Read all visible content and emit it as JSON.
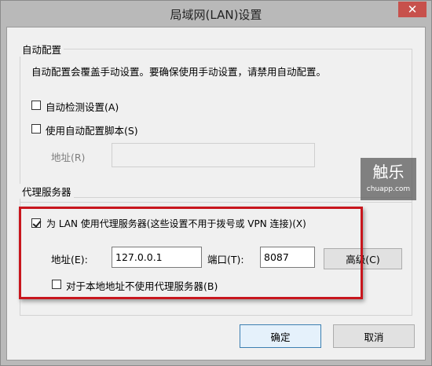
{
  "window": {
    "title": "局域网(LAN)设置",
    "close_label": "✕"
  },
  "auto_config": {
    "group_title": "自动配置",
    "description": "自动配置会覆盖手动设置。要确保使用手动设置，请禁用自动配置。",
    "auto_detect_label": "自动检测设置(A)",
    "auto_detect_checked": false,
    "use_script_label": "使用自动配置脚本(S)",
    "use_script_checked": false,
    "address_label": "地址(R)",
    "address_value": ""
  },
  "proxy": {
    "group_title": "代理服务器",
    "use_proxy_label": "为 LAN 使用代理服务器(这些设置不用于拨号或 VPN 连接)(X)",
    "use_proxy_checked": true,
    "address_label": "地址(E):",
    "address_value": "127.0.0.1",
    "port_label": "端口(T):",
    "port_value": "8087",
    "advanced_label": "高级(C)",
    "bypass_local_label": "对于本地地址不使用代理服务器(B)",
    "bypass_local_checked": false
  },
  "buttons": {
    "ok_label": "确定",
    "cancel_label": "取消"
  },
  "watermark": {
    "main": "触乐",
    "sub": "chuapp.com"
  },
  "colors": {
    "highlight": "#c8161d",
    "close_button": "#c7514c",
    "focus_border": "#3c7fb1"
  }
}
